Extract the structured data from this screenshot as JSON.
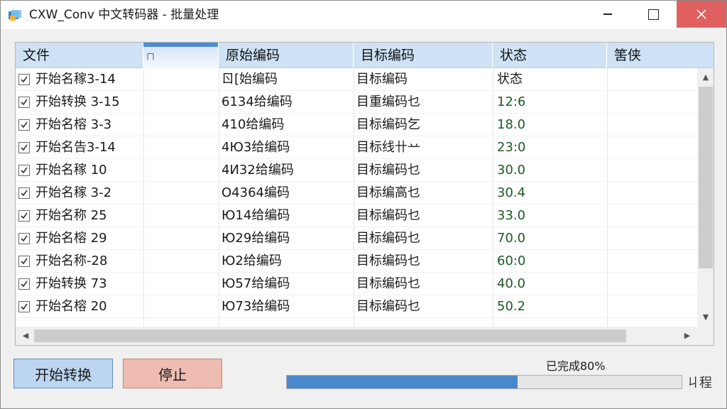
{
  "window": {
    "title": "CXW_Conv 中文转码器 - 批量处理"
  },
  "colors": {
    "header_bg": "#cfe2f5",
    "start_button": "#bcd6f1",
    "stop_button": "#eebcb1",
    "progress_fill": "#4a88cc",
    "close_button": "#e06060"
  },
  "table": {
    "columns": [
      "文件",
      "ㄇ",
      "原始编码",
      "目标编码",
      "状态",
      "筈侠"
    ],
    "rows": [
      {
        "file": "开始名稼3-14",
        "source": "ㄖ[始编码",
        "target": "目标编码",
        "status": "状态"
      },
      {
        "file": "开始转换 3-15",
        "source": "6134给编码",
        "target": "目重编码乜",
        "status": "12:6"
      },
      {
        "file": "开始名榕 3-3",
        "source": "410给编码",
        "target": "目标编码乞",
        "status": "18.0"
      },
      {
        "file": "开始名告3-14",
        "source": "4Ю3给编码",
        "target": "目标线卄䒑",
        "status": "23:0"
      },
      {
        "file": "开始名稼 10",
        "source": "4И32给编码",
        "target": "目标编码乜",
        "status": "30.0"
      },
      {
        "file": "开始名稼 3-2",
        "source": "О4364编码",
        "target": "目标编高乜",
        "status": "30.4"
      },
      {
        "file": "开始名称 25",
        "source": "Ю14给编码",
        "target": "目标编码乜",
        "status": "33.0"
      },
      {
        "file": "开始名榕 29",
        "source": "Ю29给编码",
        "target": "目标编码乜",
        "status": "70.0"
      },
      {
        "file": "开始名称-28",
        "source": "Ю2给编码",
        "target": "目标编码乜",
        "status": "60:0"
      },
      {
        "file": "开始转换 73",
        "source": "Ю57给编码",
        "target": "目标编码乜",
        "status": "40.0"
      },
      {
        "file": "开始名榕 20",
        "source": "Ю73给编码",
        "target": "目标编码乜",
        "status": "50.2"
      }
    ]
  },
  "buttons": {
    "start": "开始转换",
    "stop": "停止"
  },
  "progress": {
    "label": "已完成80%",
    "value": 0.8,
    "fill_ratio": 0.585,
    "caption": "ㄐ程"
  }
}
